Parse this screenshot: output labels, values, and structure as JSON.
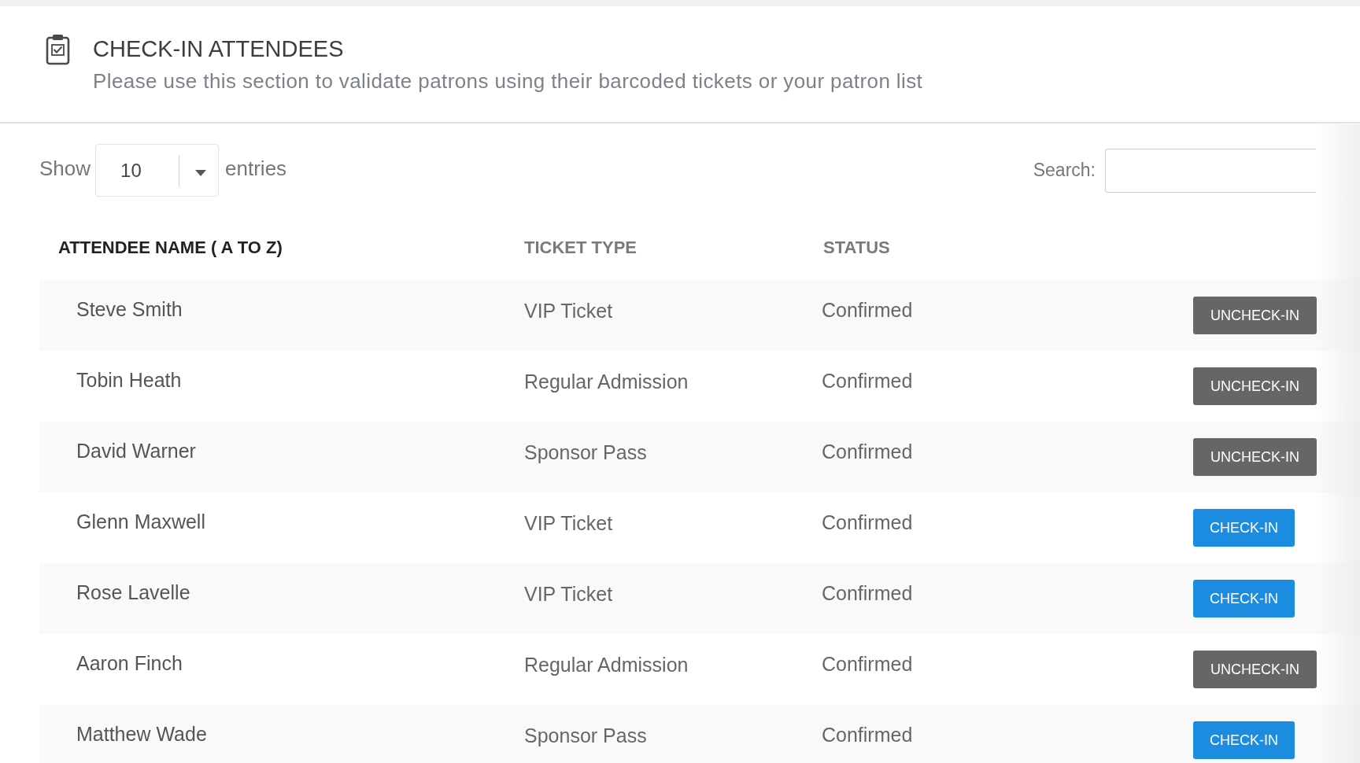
{
  "header": {
    "title": "CHECK-IN ATTENDEES",
    "subtitle": "Please use this section to validate patrons using their barcoded tickets or your patron list"
  },
  "length_menu": {
    "label_before": "Show",
    "value": "10",
    "label_after": "entries"
  },
  "search": {
    "label": "Search:"
  },
  "table": {
    "columns": [
      {
        "label": "ATTENDEE NAME ( A TO Z)",
        "sorted": true
      },
      {
        "label": "TICKET TYPE",
        "sorted": false
      },
      {
        "label": "STATUS",
        "sorted": false
      }
    ],
    "rows": [
      {
        "name": "Steve Smith",
        "ticket_type": "VIP Ticket",
        "status": "Confirmed",
        "checked_in": true,
        "action": "UNCHECK-IN"
      },
      {
        "name": "Tobin Heath",
        "ticket_type": "Regular Admission",
        "status": "Confirmed",
        "checked_in": true,
        "action": "UNCHECK-IN"
      },
      {
        "name": "David Warner",
        "ticket_type": "Sponsor Pass",
        "status": "Confirmed",
        "checked_in": true,
        "action": "UNCHECK-IN"
      },
      {
        "name": "Glenn Maxwell",
        "ticket_type": "VIP Ticket",
        "status": "Confirmed",
        "checked_in": false,
        "action": "CHECK-IN"
      },
      {
        "name": "Rose Lavelle",
        "ticket_type": "VIP Ticket",
        "status": "Confirmed",
        "checked_in": false,
        "action": "CHECK-IN"
      },
      {
        "name": "Aaron Finch",
        "ticket_type": "Regular Admission",
        "status": "Confirmed",
        "checked_in": true,
        "action": "UNCHECK-IN"
      },
      {
        "name": "Matthew Wade",
        "ticket_type": "Sponsor Pass",
        "status": "Confirmed",
        "checked_in": false,
        "action": "CHECK-IN"
      }
    ]
  }
}
